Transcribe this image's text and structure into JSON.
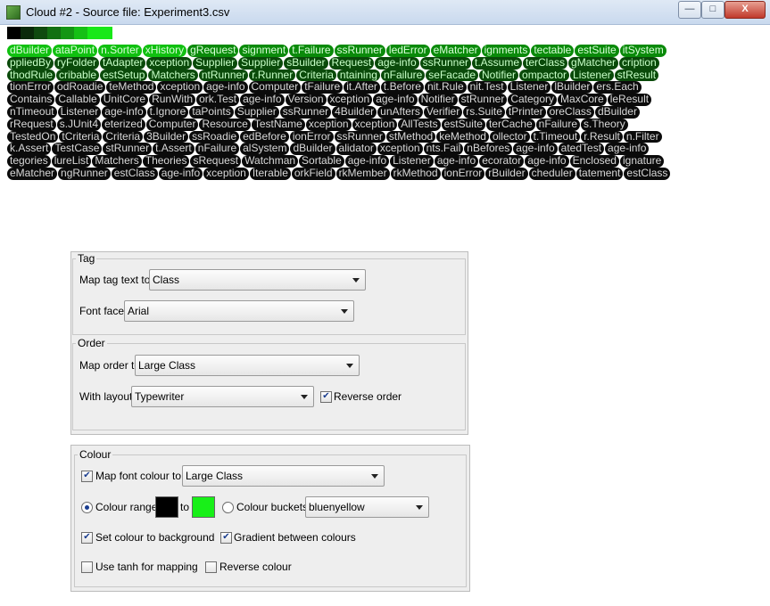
{
  "window": {
    "title": "Cloud #2 - Source file: Experiment3.csv",
    "min_symbol": "—",
    "max_symbol": "□",
    "close_symbol": "X"
  },
  "swatch_colors": [
    "#000000",
    "#0a2a0a",
    "#0f4a0f",
    "#127012",
    "#149614",
    "#16c016",
    "#18e818"
  ],
  "tag_rows": [
    [
      "dBuilder",
      "ataPoint",
      "n.Sorter",
      "xHistory",
      "gRequest",
      "signment",
      "t.Failure",
      "ssRunner",
      "ledError",
      "eMatcher",
      "ignments",
      "tectable",
      "estSuite",
      "itSystem"
    ],
    [
      "ppliedBy",
      "ryFolder",
      "tAdapter",
      "xception",
      "Supplier",
      "Supplier",
      "sBuilder",
      "Request",
      "age-info",
      "ssRunner",
      "t.Assume",
      "terClass",
      "gMatcher",
      "cription"
    ],
    [
      "thodRule",
      "cribable",
      "estSetup",
      "Matchers",
      "ntRunner",
      "r.Runner",
      "Criteria",
      "ntaining",
      "nFailure",
      "seFacade",
      "Notifier",
      "ompactor",
      "Listener",
      "stResult"
    ],
    [
      "tionError",
      "odRoadie",
      "teMethod",
      "xception",
      "age-info",
      "Computer",
      "tFailure",
      "it.After",
      "t.Before",
      "nit.Rule",
      "nit.Test",
      "Listener",
      "lBuilder",
      "ers.Each"
    ],
    [
      "Contains",
      "Callable",
      "UnitCore",
      "RunWith",
      "ork.Test",
      "age-info",
      "Version",
      "xception",
      "age-info",
      "Notifier",
      "stRunner",
      "Category",
      "MaxCore",
      "leResult"
    ],
    [
      "nTimeout",
      "Listener",
      "age-info",
      "t.Ignore",
      "taPoints",
      "Supplier",
      "ssRunner",
      "4Builder",
      "unAfters",
      "Verifier",
      "rs.Suite",
      "tPrinter",
      "oreClass",
      "dBuilder"
    ],
    [
      "rRequest",
      "s.JUnit4",
      "eterized",
      "Computer",
      "Resource",
      "TestName",
      "xception",
      "xception",
      "AllTests",
      "estSuite",
      "terCache",
      "nFailure",
      "s.Theory"
    ],
    [
      "TestedOn",
      "tCriteria",
      "Criteria",
      "3Builder",
      "ssRoadie",
      "edBefore",
      "ionError",
      "ssRunner",
      "stMethod",
      "keMethod",
      "ollector",
      "t.Timeout",
      "r.Result",
      "n.Filter"
    ],
    [
      "k.Assert",
      "TestCase",
      "stRunner",
      "t.Assert",
      "nFailure",
      "alSystem",
      "dBuilder",
      "alidator",
      "xception",
      "nts.Fail",
      "nBefores",
      "age-info",
      "atedTest",
      "age-info"
    ],
    [
      "tegories",
      "lureList",
      "Matchers",
      "Theories",
      "sRequest",
      "Watchman",
      "Sortable",
      "age-info",
      "Listener",
      "age-info",
      "ecorator",
      "age-info",
      "Enclosed",
      "ignature"
    ],
    [
      "eMatcher",
      "ngRunner",
      "estClass",
      "age-info",
      "xception",
      "Iterable",
      "orkField",
      "rkMember",
      "rkMethod",
      "ionError",
      "rBuilder",
      "cheduler",
      "tatement",
      "estClass"
    ]
  ],
  "tag_panel": {
    "legend": "Tag",
    "map_text_label": "Map tag text to",
    "map_text_value": "Class",
    "font_face_label": "Font face",
    "font_face_value": "Arial"
  },
  "order_panel": {
    "legend": "Order",
    "map_order_label": "Map order to",
    "map_order_value": "Large Class",
    "layout_label": "With layout",
    "layout_value": "Typewriter",
    "reverse_label": "Reverse order",
    "reverse_checked": true
  },
  "colour_panel": {
    "legend": "Colour",
    "map_font_label": "Map font colour to",
    "map_font_checked": true,
    "map_font_value": "Large Class",
    "range_label": "Colour range",
    "range_selected": true,
    "to_label": "to",
    "range_from_color": "#000000",
    "range_to_color": "#18f018",
    "buckets_label": "Colour buckets",
    "buckets_value": "bluenyellow",
    "background_label": "Set colour to background",
    "background_checked": true,
    "gradient_label": "Gradient between colours",
    "gradient_checked": true,
    "tanh_label": "Use tanh for mapping",
    "tanh_checked": false,
    "reverse_colour_label": "Reverse colour",
    "reverse_colour_checked": false
  }
}
